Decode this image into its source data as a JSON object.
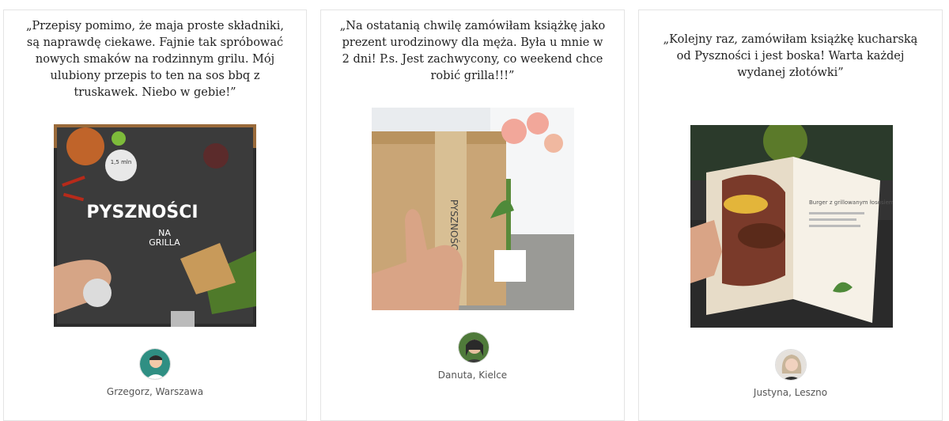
{
  "testimonials": [
    {
      "quote": "„Przepisy pomimo, że maja proste składniki, są naprawdę ciekawe. Fajnie tak spróbować nowych smaków na rodzinnym grilu. Mój ulubiony przepis to ten na sos bbq z truskawek. Niebo w gebie!”",
      "author": "Grzegorz, Warszawa",
      "book_title_line1": "PYSZNOŚCI",
      "book_title_line2": "NA",
      "book_title_line3": "GRILLA",
      "badge_line1": "1,5 mln",
      "accent_color": "#2f8f83"
    },
    {
      "quote": "„Na ostatanią chwilę zamówiłam książkę jako prezent urodzinowy dla męża. Była u mnie w 2 dni! P.s. Jest zachwycony, co weekend chce robić grilla!!!”",
      "author": "Danuta, Kielce",
      "tape_text": "PYSZNOŚCI",
      "accent_color": "#b08d5e"
    },
    {
      "quote": "„Kolejny raz, zamówiłam książkę kucharską od Pyszności i jest boska! Warta każdej wydanej złotówki”",
      "author": "Justyna, Leszno",
      "page_heading": "Burger z grillowanym łososiem",
      "accent_color": "#3a3a3a"
    }
  ]
}
